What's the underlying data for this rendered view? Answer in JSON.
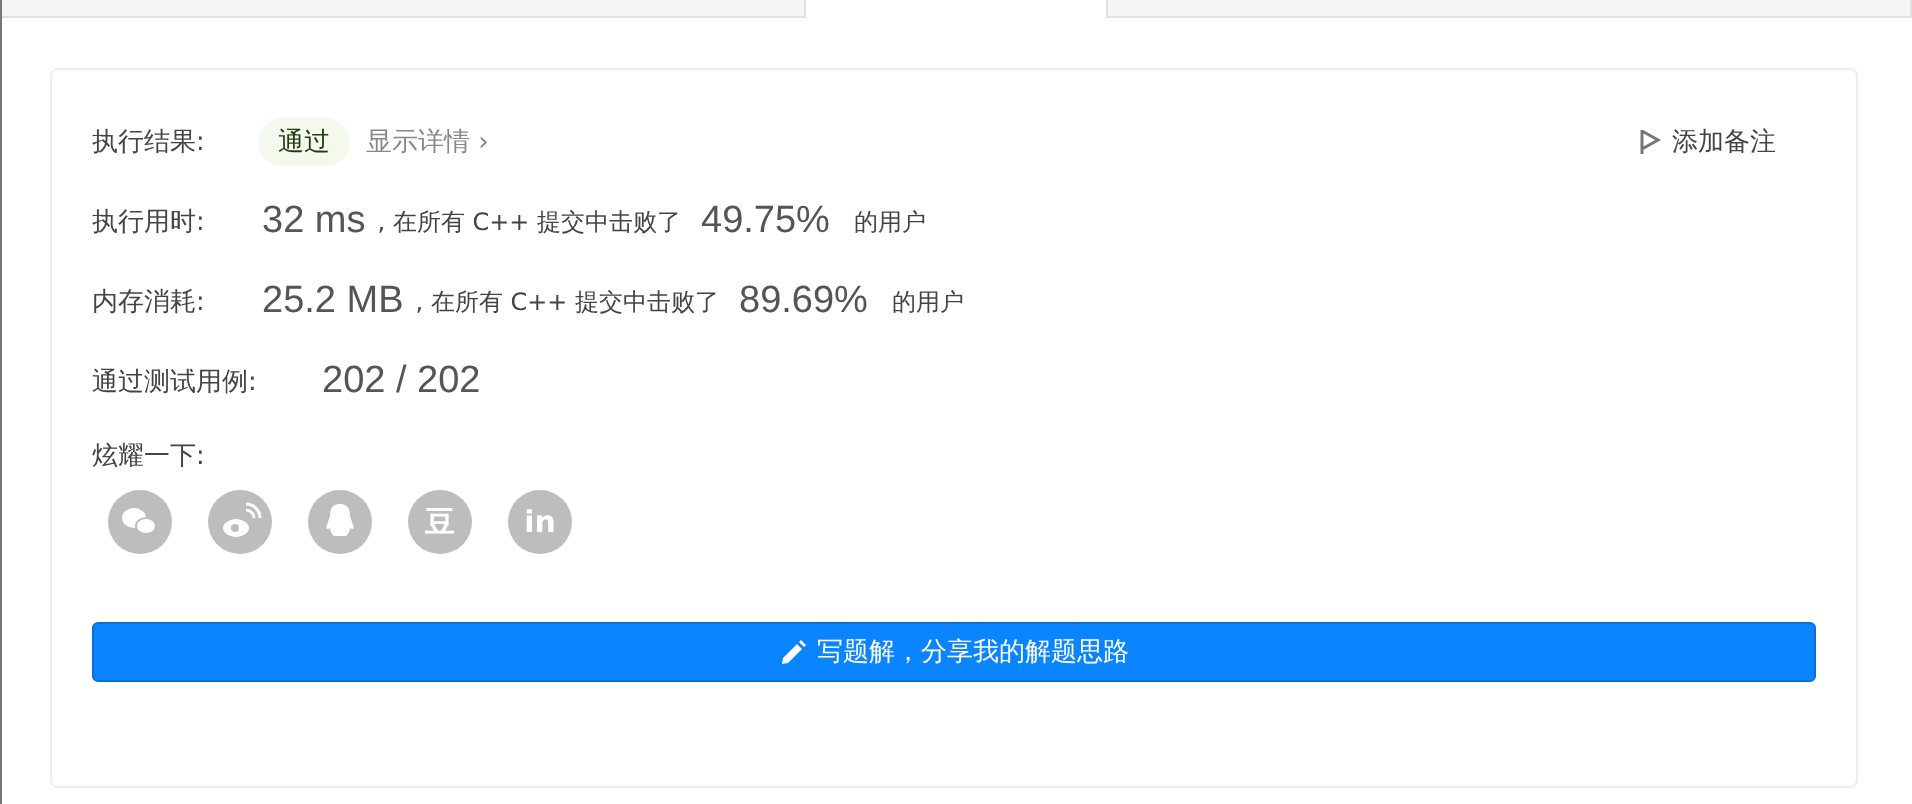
{
  "tabs": [
    {
      "selected": false
    },
    {
      "selected": true
    },
    {
      "selected": false
    }
  ],
  "result": {
    "label": "执行结果:",
    "status": "通过",
    "details_link": "显示详情",
    "details_caret": "›",
    "note_button": "添加备注"
  },
  "stats": [
    {
      "label": "执行用时:",
      "value": "32 ms",
      "text": ", 在所有 C++ 提交中击败了",
      "percent": "49.75%",
      "suffix": "的用户"
    },
    {
      "label": "内存消耗:",
      "value": "25.2 MB",
      "text": ", 在所有 C++ 提交中击败了",
      "percent": "89.69%",
      "suffix": "的用户"
    }
  ],
  "tests": {
    "label": "通过测试用例:",
    "value": "202 / 202"
  },
  "share": {
    "label": "炫耀一下:",
    "icons": [
      {
        "kind": "wechat"
      },
      {
        "kind": "weibo"
      },
      {
        "kind": "qq"
      },
      {
        "kind": "douban",
        "glyph": "豆"
      },
      {
        "kind": "linkedin",
        "glyph": "in"
      }
    ]
  },
  "write_button": "写题解，分享我的解题思路"
}
